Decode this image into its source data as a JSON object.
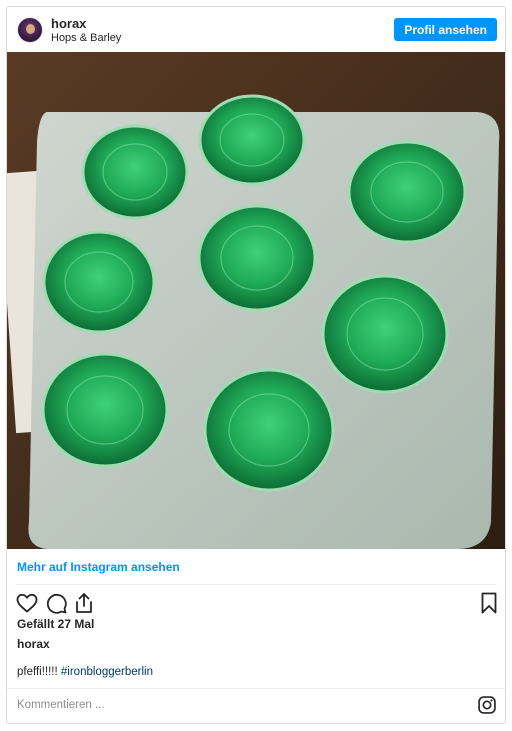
{
  "post": {
    "username": "horax",
    "location": "Hops & Barley",
    "profile_button": "Profil ansehen",
    "more_link": "Mehr auf Instagram ansehen",
    "likes": "Gefällt 27 Mal",
    "caption_user": "horax",
    "caption_text": "pfeffi!!!!! ",
    "caption_hashtag": "#ironbloggerberlin",
    "comment_placeholder": "Kommentieren ..."
  },
  "icons": {
    "avatar": "profile-avatar",
    "like": "heart-icon",
    "comment": "comment-icon",
    "share": "share-icon",
    "save": "bookmark-icon",
    "brand": "instagram-icon"
  },
  "colors": {
    "accent": "#0095f6",
    "hashtag": "#00376b",
    "text": "#262626",
    "muted": "#8e8e8e"
  }
}
